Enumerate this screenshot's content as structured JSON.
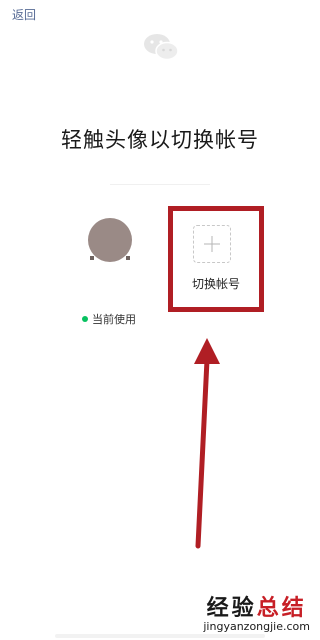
{
  "nav": {
    "back_label": "返回"
  },
  "page": {
    "title": "轻触头像以切换帐号"
  },
  "current_account": {
    "status_text": "当前使用",
    "status_color": "#07c160",
    "avatar_color": "#9a8a86"
  },
  "switch_account": {
    "label": "切换帐号",
    "icon": "plus-icon",
    "highlight_color": "#b01e24"
  },
  "annotation": {
    "arrow_color": "#b01e24"
  },
  "watermark": {
    "cn_part1": "经验",
    "cn_part2": "总结",
    "url": "jingyanzongjie.com"
  }
}
